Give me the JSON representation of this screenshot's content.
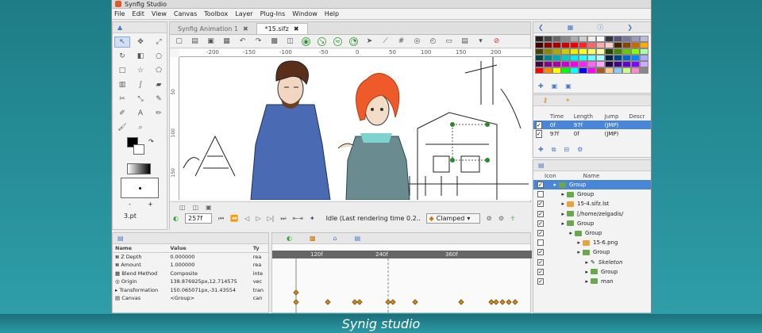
{
  "window": {
    "title": "Synfig Studio"
  },
  "menu": [
    "File",
    "Edit",
    "View",
    "Canvas",
    "Toolbox",
    "Layer",
    "Plug-Ins",
    "Window",
    "Help"
  ],
  "tabs": [
    {
      "label": "Synfig Animation 1"
    },
    {
      "label": "*15.sifz"
    }
  ],
  "ruler": {
    "h": [
      "-200",
      "-150",
      "-100",
      "-50",
      "0",
      "50",
      "100",
      "150",
      "200"
    ],
    "v": [
      "50",
      "100",
      "150"
    ]
  },
  "toolbox": {
    "line_width": "3.pt",
    "minus": "-",
    "plus": "+"
  },
  "canvas_bottom": {
    "frame": "257f",
    "status": "Idle (Last rendering time 0.2...",
    "interp": "Clamped"
  },
  "params": {
    "headers": [
      "Name",
      "Value",
      "Ty"
    ],
    "rows": [
      {
        "name": "Z Depth",
        "value": "0.000000",
        "type": "rea"
      },
      {
        "name": "Amount",
        "value": "1.000000",
        "type": "rea"
      },
      {
        "name": "Blend Method",
        "value": "Composite",
        "type": "inte"
      },
      {
        "name": "Origin",
        "value": "138.876925px,12.714575",
        "type": "vec"
      },
      {
        "name": "Transformation",
        "value": "150.065071px,-31.43554",
        "type": "tran"
      },
      {
        "name": "Canvas",
        "value": "<Group>",
        "type": "can"
      }
    ]
  },
  "timetrack": {
    "labels": [
      "120f",
      "240f",
      "360f"
    ]
  },
  "keyframes": {
    "headers": [
      "Time",
      "Length",
      "Jump",
      "Descr"
    ],
    "rows": [
      {
        "time": "0f",
        "length": "97f",
        "jump": "(JMP)"
      },
      {
        "time": "97f",
        "length": "0f",
        "jump": "(JMP)"
      }
    ]
  },
  "layers": {
    "headers": [
      "Icon",
      "Name"
    ],
    "rows": [
      {
        "name": "Group",
        "indent": 0,
        "sel": true,
        "check": "✓",
        "color": "g"
      },
      {
        "name": "Group",
        "indent": 1,
        "check": "",
        "color": "g"
      },
      {
        "name": "15-4.sifz.lst",
        "indent": 1,
        "check": "✓",
        "color": "o"
      },
      {
        "name": "[/home/zelgadis/",
        "indent": 1,
        "check": "✓",
        "color": "g"
      },
      {
        "name": "Group",
        "indent": 1,
        "check": "✓",
        "color": "g"
      },
      {
        "name": "Group",
        "indent": 2,
        "check": "✓",
        "color": "g"
      },
      {
        "name": "15-6.png",
        "indent": 3,
        "check": "",
        "color": "o"
      },
      {
        "name": "Group",
        "indent": 3,
        "check": "✓",
        "color": "g"
      },
      {
        "name": "Skeleton",
        "indent": 4,
        "check": "✓",
        "color": "s"
      },
      {
        "name": "Group",
        "indent": 4,
        "check": "✓",
        "color": "g"
      },
      {
        "name": "man",
        "indent": 4,
        "check": "✓",
        "color": "g"
      }
    ]
  },
  "palette_colors": [
    "#222",
    "#444",
    "#666",
    "#888",
    "#aaa",
    "#ccc",
    "#eee",
    "#fff",
    "#334",
    "#557",
    "#779",
    "#99b",
    "#bbd",
    "#400",
    "#800",
    "#a00",
    "#c00",
    "#e00",
    "#f22",
    "#f66",
    "#faa",
    "#fcc",
    "#420",
    "#840",
    "#c60",
    "#fa0",
    "#440",
    "#880",
    "#aa0",
    "#cc0",
    "#ee0",
    "#ff2",
    "#ff6",
    "#ffa",
    "#240",
    "#480",
    "#6c0",
    "#8f0",
    "#afa",
    "#044",
    "#088",
    "#0aa",
    "#0cc",
    "#0ee",
    "#2ff",
    "#6ff",
    "#aff",
    "#024",
    "#048",
    "#06c",
    "#08f",
    "#aaf",
    "#404",
    "#808",
    "#a0a",
    "#c0c",
    "#e0e",
    "#f2f",
    "#f6f",
    "#faf",
    "#204",
    "#408",
    "#60c",
    "#80f",
    "#caf",
    "#f00",
    "#f80",
    "#ff0",
    "#0f0",
    "#0ff",
    "#00f",
    "#f0f",
    "#a52",
    "#fc8",
    "#8cf",
    "#cf8",
    "#f8c",
    "#888"
  ],
  "caption": "Synig studio"
}
